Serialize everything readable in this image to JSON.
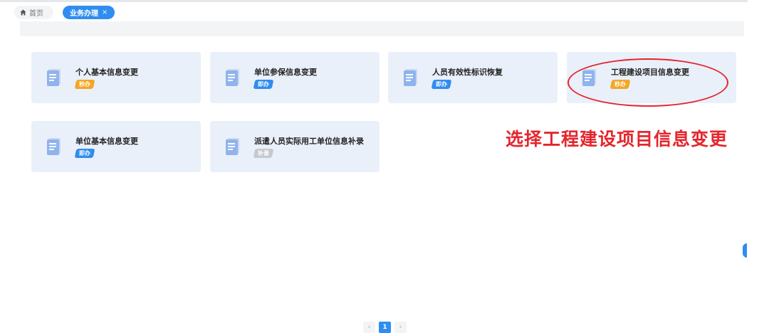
{
  "tabs": {
    "home_label": "首页",
    "active_label": "业务办理",
    "close_glyph": "×"
  },
  "cards": [
    {
      "title": "个人基本信息变更",
      "badge": "秒办",
      "badge_color": "#f5a623"
    },
    {
      "title": "单位参保信息变更",
      "badge": "即办",
      "badge_color": "#2f8df0"
    },
    {
      "title": "人员有效性标识恢复",
      "badge": "即办",
      "badge_color": "#2f8df0"
    },
    {
      "title": "工程建设项目信息变更",
      "badge": "秒办",
      "badge_color": "#f5a623"
    },
    {
      "title": "单位基本信息变更",
      "badge": "即办",
      "badge_color": "#2f8df0"
    },
    {
      "title": "派遣人员实际用工单位信息补录",
      "badge": "补录",
      "badge_color": "#c5c9cf"
    }
  ],
  "annotation": {
    "text": "选择工程建设项目信息变更",
    "color": "#e4262d"
  },
  "pagination": {
    "prev": "‹",
    "current": "1",
    "next": "›"
  },
  "colors": {
    "accent": "#2f8df0",
    "card_bg": "#eaf0fa",
    "badge_orange": "#f5a623",
    "badge_gray": "#c5c9cf"
  },
  "icons": {
    "home": "home-icon",
    "card": "document-icon",
    "close": "close-icon"
  }
}
